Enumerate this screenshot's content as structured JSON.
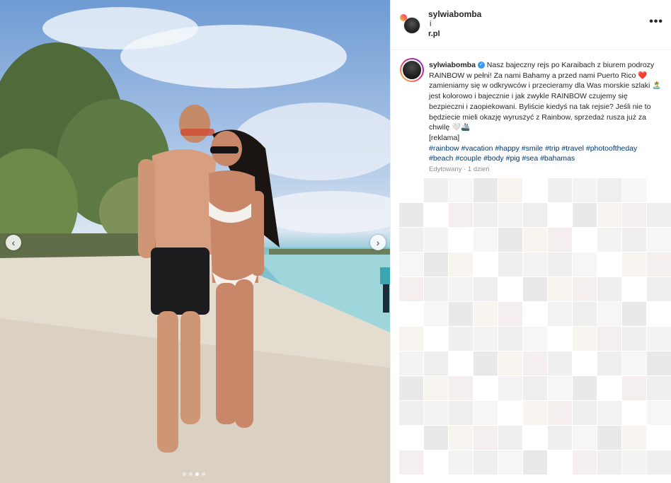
{
  "post": {
    "carousel": {
      "prev_icon": "chevron-left-icon",
      "next_icon": "chevron-right-icon",
      "dots": 4,
      "active_dot": 3
    },
    "header": {
      "username": "sylwiabomba",
      "sub_line_1": "i",
      "sub_line_2": "r.pl",
      "more_icon": "more-horizontal-icon",
      "more_label": "•••"
    },
    "caption": {
      "username": "sylwiabomba",
      "verified_icon": "verified-badge-icon",
      "text_1": "Nasz bajeczny rejs po Karaibach z biurem podrozy RAINBOW w pełni! Za nami Bahamy a przed nami Puerto Rico",
      "emoji_heart": "❤️",
      "text_2": "zamieniamy się w odkrywców i przecieramy dla Was morskie szlaki",
      "emoji_island": "🏝️",
      "text_3": "jest kolorowo i bajecznie i jak zwykle RAINBOW czujemy się bezpieczni i zaopiekowani. Byliście kiedyś na tak rejsie? Jeśli nie to będziecie mieli okazję wyruszyć z Rainbow, sprzedaż rusza już za chwilę",
      "emoji_end": "🤍🚢",
      "ad_label": "[reklama]",
      "hashtags": [
        "#rainbow",
        "#vacation",
        "#happy",
        "#smile",
        "#trip",
        "#travel",
        "#photooftheday",
        "#beach",
        "#couple",
        "#body",
        "#pig",
        "#sea",
        "#bahamas"
      ],
      "meta": "Edytowany · 1 dzień"
    }
  }
}
